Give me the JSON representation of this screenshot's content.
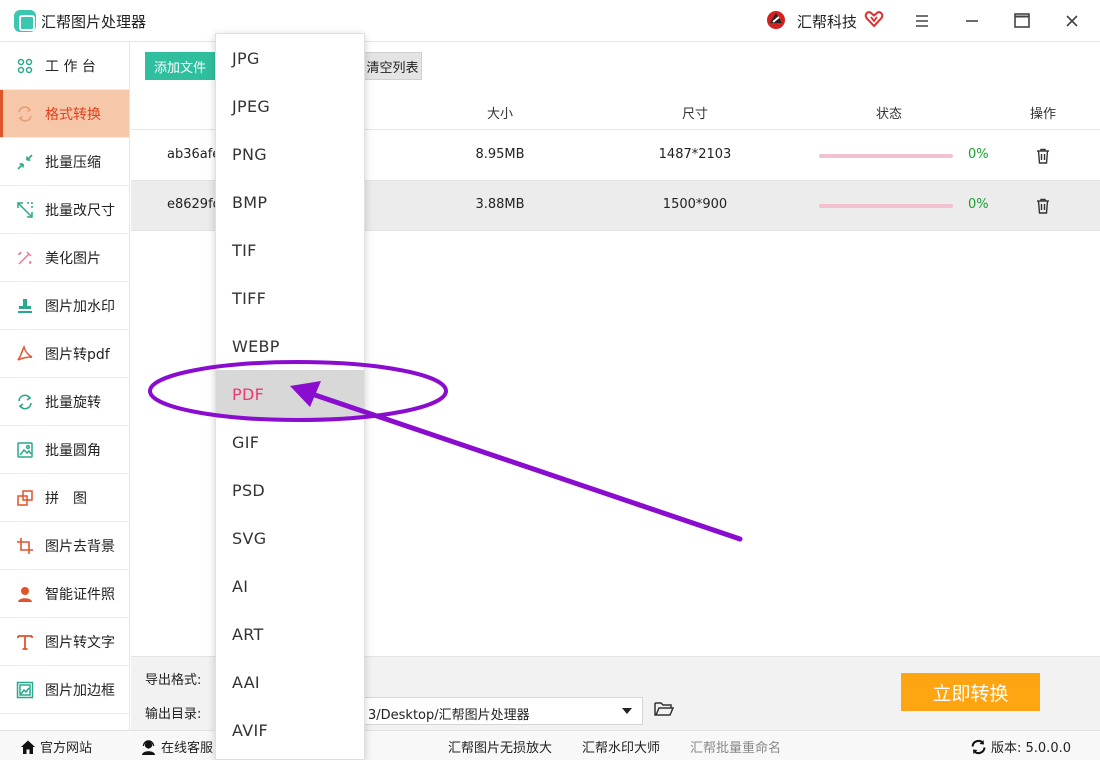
{
  "window": {
    "title": "汇帮图片处理器",
    "brand": "汇帮科技"
  },
  "sidebar": {
    "items": [
      {
        "label": "工 作 台",
        "icon": "grid-icon"
      },
      {
        "label": "格式转换",
        "icon": "convert-icon",
        "active": true
      },
      {
        "label": "批量压缩",
        "icon": "compress-icon"
      },
      {
        "label": "批量改尺寸",
        "icon": "resize-icon"
      },
      {
        "label": "美化图片",
        "icon": "beautify-icon"
      },
      {
        "label": "图片加水印",
        "icon": "watermark-icon"
      },
      {
        "label": "图片转pdf",
        "icon": "pdf-icon"
      },
      {
        "label": "批量旋转",
        "icon": "rotate-icon"
      },
      {
        "label": "批量圆角",
        "icon": "round-corner-icon"
      },
      {
        "label": "拼　图",
        "icon": "collage-icon"
      },
      {
        "label": "图片去背景",
        "icon": "crop-icon"
      },
      {
        "label": "智能证件照",
        "icon": "person-icon"
      },
      {
        "label": "图片转文字",
        "icon": "text-icon"
      },
      {
        "label": "图片加边框",
        "icon": "frame-icon"
      }
    ]
  },
  "toolbar": {
    "add_label": "添加文件",
    "clear_label": "清空列表"
  },
  "table": {
    "headers": {
      "size": "大小",
      "dims": "尺寸",
      "status": "状态",
      "action": "操作"
    },
    "rows": [
      {
        "name": "ab36afe",
        "size": "8.95MB",
        "dims": "1487*2103",
        "progress": 0,
        "pct": "0%"
      },
      {
        "name": "e8629fd",
        "size": "3.88MB",
        "dims": "1500*900",
        "progress": 0,
        "pct": "0%"
      }
    ]
  },
  "bottom": {
    "format_label": "导出格式:",
    "outdir_label": "输出目录:",
    "outdir_value": "3/Desktop/汇帮图片处理器",
    "convert_label": "立即转换"
  },
  "footer": {
    "website": "官方网站",
    "support": "在线客服",
    "link1": "汇帮图片无损放大",
    "link2": "汇帮水印大师",
    "link3": "汇帮批量重命名",
    "version": "版本: 5.0.0.0"
  },
  "dropdown": {
    "options": [
      "JPG",
      "JPEG",
      "PNG",
      "BMP",
      "TIF",
      "TIFF",
      "WEBP",
      "PDF",
      "GIF",
      "PSD",
      "SVG",
      "AI",
      "ART",
      "AAI",
      "AVIF"
    ],
    "selected": "PDF"
  },
  "colors": {
    "accent_teal": "#2fbf9f",
    "active_bg": "#f6c7a9",
    "convert_orange": "#ffa512",
    "annotation_purple": "#8a0ccf",
    "selected_text": "#e83c6e"
  }
}
